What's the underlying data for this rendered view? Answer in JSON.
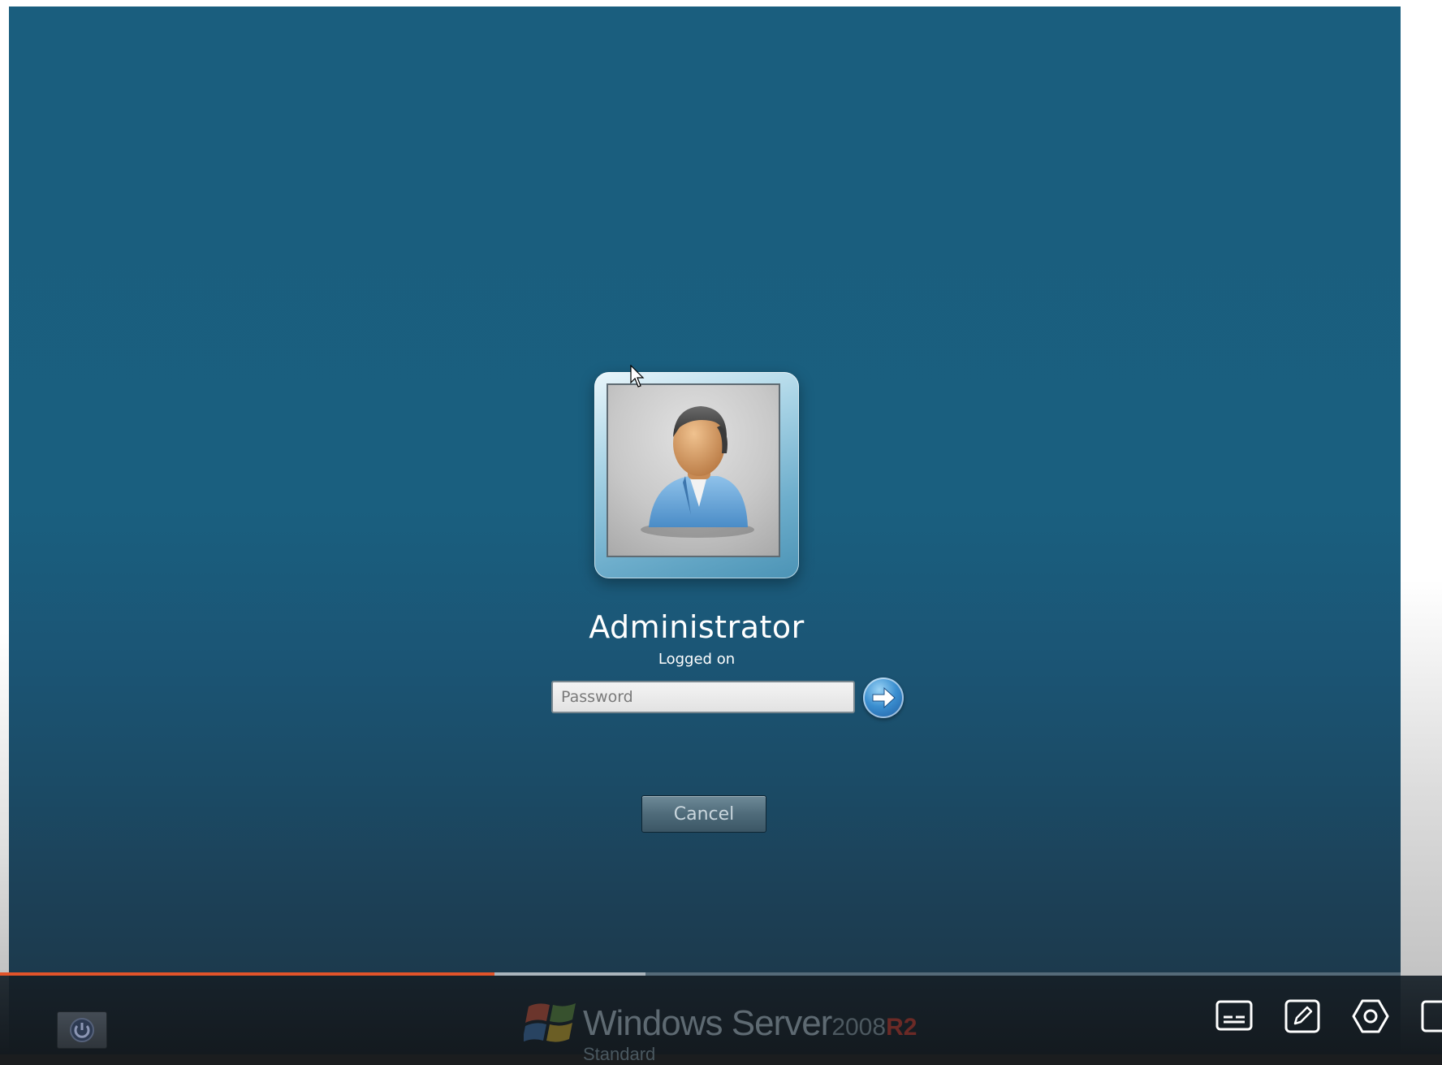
{
  "login": {
    "username": "Administrator",
    "status": "Logged on",
    "password_placeholder": "Password",
    "password_value": "",
    "cancel_label": "Cancel"
  },
  "branding": {
    "product": "Windows Server",
    "year": "2008",
    "release": "R2",
    "edition": "Standard"
  },
  "icons": {
    "user_picture": "user-avatar-icon",
    "submit": "arrow-right-icon",
    "power": "power-options-icon",
    "windows_logo": "windows-flag-icon",
    "player_controls": [
      "subtitles-icon",
      "edit-icon",
      "settings-icon",
      "fullscreen-icon"
    ]
  },
  "player": {
    "progress_played": 0.353,
    "progress_buffered": 0.461
  },
  "colors": {
    "background": "#1a5e7e",
    "progress": "#e2542a",
    "branding_r2": "#6b2a26"
  }
}
